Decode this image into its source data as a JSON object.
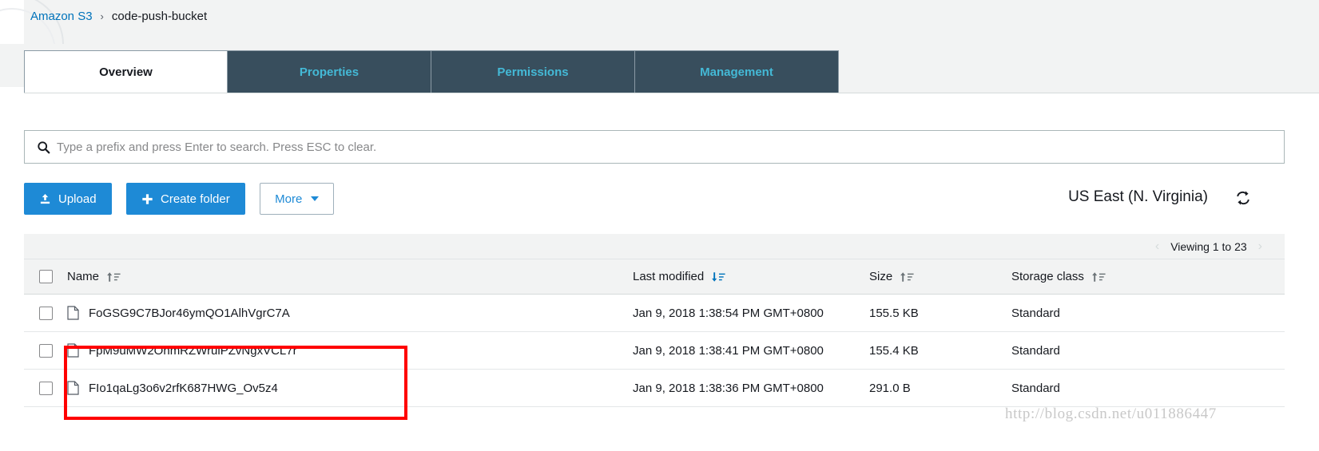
{
  "breadcrumb": {
    "root": "Amazon S3",
    "separator": "›",
    "current": "code-push-bucket"
  },
  "tabs": [
    {
      "label": "Overview",
      "active": true
    },
    {
      "label": "Properties",
      "active": false
    },
    {
      "label": "Permissions",
      "active": false
    },
    {
      "label": "Management",
      "active": false
    }
  ],
  "search": {
    "icon": "search-icon",
    "placeholder": "Type a prefix and press Enter to search. Press ESC to clear.",
    "value": ""
  },
  "toolbar": {
    "upload_label": "Upload",
    "upload_icon": "upload-icon",
    "create_folder_label": "Create folder",
    "create_folder_icon": "plus-icon",
    "more_label": "More",
    "more_icon": "chevron-down-icon",
    "region_label": "US East (N. Virginia)",
    "refresh_icon": "refresh-icon"
  },
  "pagination": {
    "prev_icon": "‹",
    "next_icon": "›",
    "text": "Viewing 1 to 23"
  },
  "table": {
    "columns": [
      {
        "label": "Name",
        "sort": "ascending"
      },
      {
        "label": "Last modified",
        "sort": "descending"
      },
      {
        "label": "Size",
        "sort": "ascending"
      },
      {
        "label": "Storage class",
        "sort": "ascending"
      }
    ],
    "rows": [
      {
        "name": "FoGSG9C7BJor46ymQO1AlhVgrC7A",
        "last_modified": "Jan 9, 2018 1:38:54 PM GMT+0800",
        "size": "155.5 KB",
        "storage_class": "Standard"
      },
      {
        "name": "FpM9uMW2OnmRZWruiPZvNgxVCL7r",
        "last_modified": "Jan 9, 2018 1:38:41 PM GMT+0800",
        "size": "155.4 KB",
        "storage_class": "Standard"
      },
      {
        "name": "FIo1qaLg3o6v2rfK687HWG_Ov5z4",
        "last_modified": "Jan 9, 2018 1:38:36 PM GMT+0800",
        "size": "291.0 B",
        "storage_class": "Standard"
      }
    ]
  },
  "annotation": {
    "highlight_color": "#ff0000"
  },
  "watermark": {
    "text": "http://blog.csdn.net/u011886447"
  },
  "colors": {
    "link": "#0073bb",
    "tab_active_bg": "#ffffff",
    "tab_inactive_bg": "#384e5d",
    "tab_inactive_text": "#44b9d6",
    "primary_button": "#1e8ad6",
    "header_bg": "#f2f3f3"
  }
}
